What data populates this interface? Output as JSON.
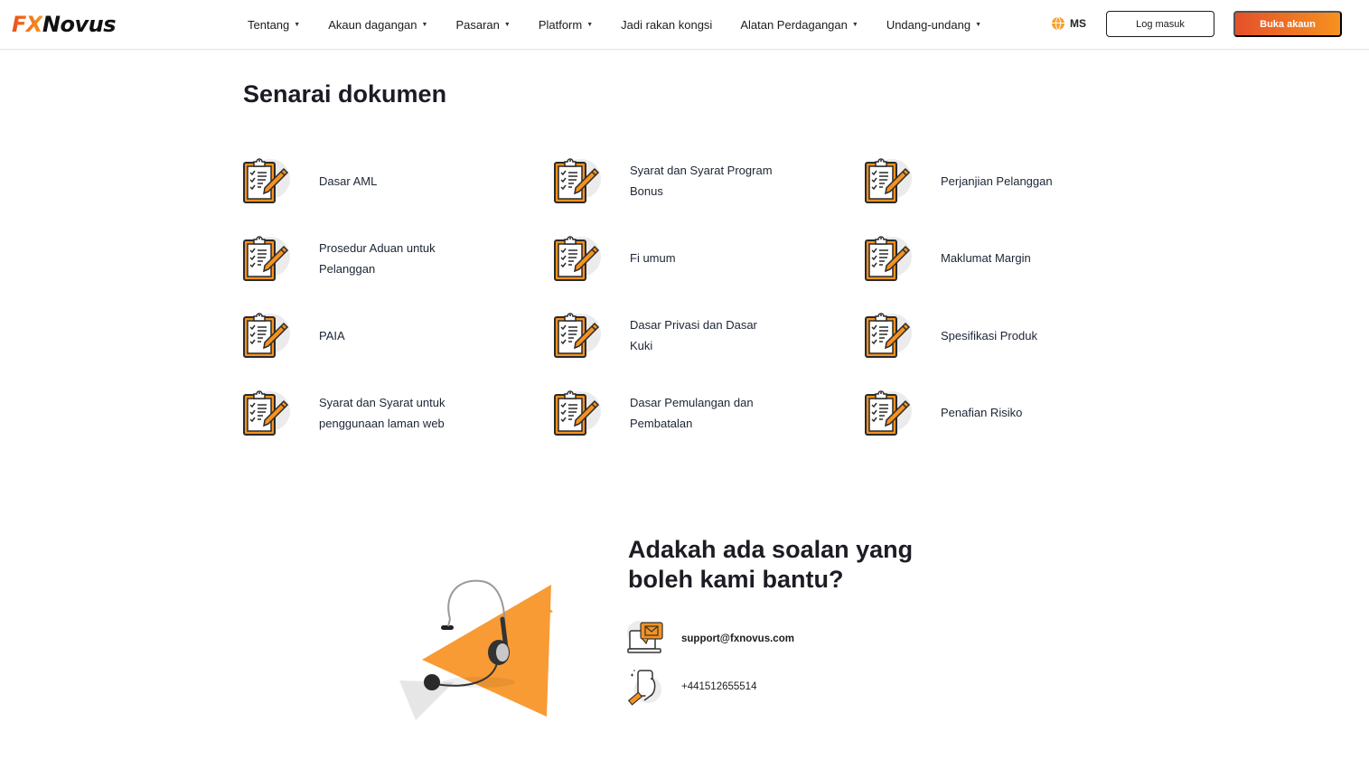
{
  "header": {
    "logo": {
      "part1": "FX",
      "part2": "Novus"
    },
    "nav": [
      {
        "label": "Tentang",
        "has_dropdown": true
      },
      {
        "label": "Akaun dagangan",
        "has_dropdown": true
      },
      {
        "label": "Pasaran",
        "has_dropdown": true
      },
      {
        "label": "Platform",
        "has_dropdown": true
      },
      {
        "label": "Jadi rakan kongsi",
        "has_dropdown": false
      },
      {
        "label": "Alatan Perdagangan",
        "has_dropdown": true
      },
      {
        "label": "Undang-undang",
        "has_dropdown": true
      }
    ],
    "caret_glyph": "▼",
    "language": {
      "icon": "globe-icon",
      "code": "MS"
    },
    "login_label": "Log masuk",
    "open_account_label": "Buka akaun"
  },
  "documents": {
    "title": "Senarai dokumen",
    "icon": "clipboard-checklist-icon",
    "items": [
      {
        "label": "Dasar AML"
      },
      {
        "label": "Syarat dan Syarat Program Bonus"
      },
      {
        "label": "Perjanjian Pelanggan"
      },
      {
        "label": "Prosedur Aduan untuk Pelanggan"
      },
      {
        "label": "Fi umum"
      },
      {
        "label": "Maklumat Margin"
      },
      {
        "label": "PAIA"
      },
      {
        "label": "Dasar Privasi dan Dasar Kuki"
      },
      {
        "label": "Spesifikasi Produk"
      },
      {
        "label": "Syarat dan Syarat untuk penggunaan laman web"
      },
      {
        "label": "Dasar Pemulangan dan Pembatalan"
      },
      {
        "label": "Penafian Risiko"
      }
    ]
  },
  "contact": {
    "title": "Adakah ada soalan yang boleh kami bantu?",
    "illustration": "headset-illustration",
    "email": {
      "icon": "email-laptop-icon",
      "value": "support@fxnovus.com"
    },
    "phone": {
      "icon": "phone-hand-icon",
      "value": "+441512655514"
    }
  },
  "colors": {
    "brand_orange": "#f5921f",
    "brand_red_orange": "#e4502a",
    "text_dark": "#1c1c24"
  }
}
